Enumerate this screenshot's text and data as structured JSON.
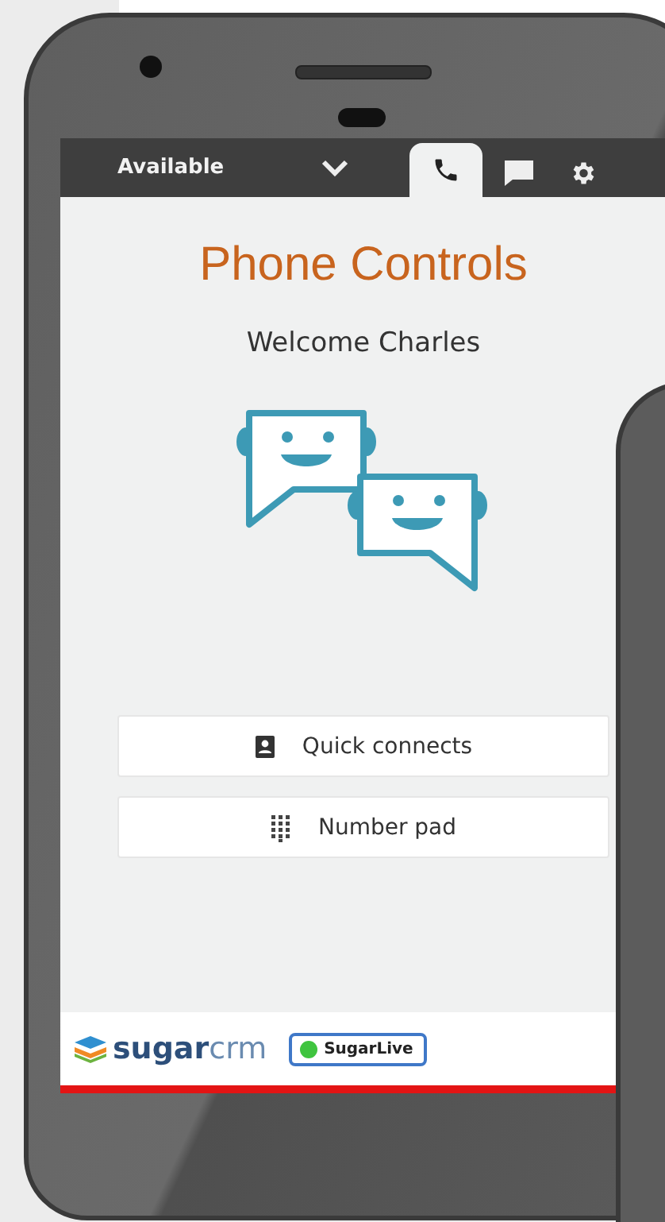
{
  "status_bar": {
    "status": "Available"
  },
  "tabs": [
    {
      "kind": "phone",
      "selected": true
    },
    {
      "kind": "chat",
      "selected": false
    },
    {
      "kind": "settings",
      "selected": false
    }
  ],
  "title": "Phone Controls",
  "welcome": "Welcome Charles",
  "buttons": [
    {
      "kind": "contacts",
      "label": "Quick connects"
    },
    {
      "kind": "keypad",
      "label": "Number pad"
    }
  ],
  "footer": {
    "logo_main": "sugar",
    "logo_accent": "crm",
    "badge": {
      "label": "SugarLive",
      "color": "#3fc43f"
    }
  }
}
